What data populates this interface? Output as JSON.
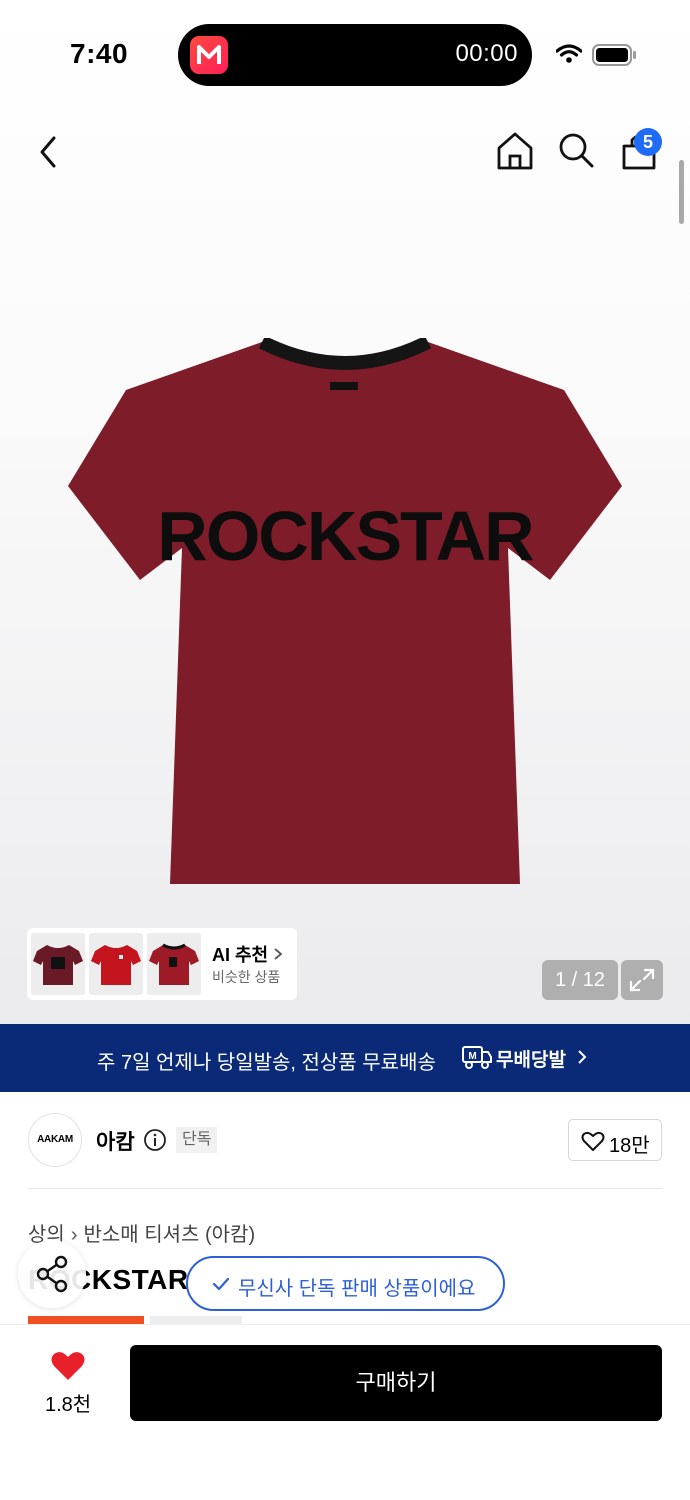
{
  "status": {
    "time": "7:40",
    "timer": "00:00"
  },
  "nav": {
    "cart_count": "5"
  },
  "product": {
    "image_text": "ROCKSTAR",
    "image_counter": "1 / 12",
    "title": "ROCKSTAR",
    "category": {
      "parent": "상의",
      "child": "반소매 티셔츠 (아캄)"
    },
    "exclusive_notice": "무신사 단독 판매 상품이에요"
  },
  "ai_recommend": {
    "title": "AI 추천",
    "subtitle": "비슷한 상품"
  },
  "shipping_banner": {
    "text": "주 7일 언제나 당일발송, 전상품 무료배송",
    "brand": "무배당발"
  },
  "brand": {
    "logo_text": "AAKAM",
    "name": "아캄",
    "tag": "단독",
    "likes": "18만"
  },
  "bottom": {
    "likes": "1.8천",
    "buy_label": "구매하기"
  },
  "colors": {
    "accent_blue": "#2d5fd6",
    "banner_navy": "#0a2a78",
    "heart_red": "#e8202a",
    "shirt_red": "#7e1c2a",
    "badge_blue": "#1e6bf5"
  }
}
